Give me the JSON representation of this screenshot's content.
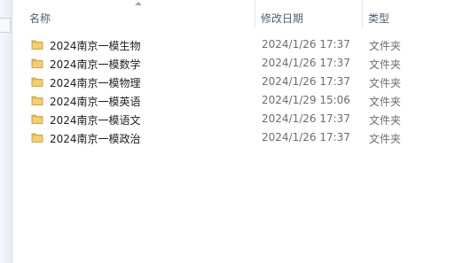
{
  "columns": {
    "name": "名称",
    "date": "修改日期",
    "type": "类型"
  },
  "files": [
    {
      "name": "2024南京一模生物",
      "date": "2024/1/26 17:37",
      "type": "文件夹",
      "icon": "folder-icon"
    },
    {
      "name": "2024南京一模数学",
      "date": "2024/1/26 17:37",
      "type": "文件夹",
      "icon": "folder-icon"
    },
    {
      "name": "2024南京一模物理",
      "date": "2024/1/26 17:37",
      "type": "文件夹",
      "icon": "folder-icon"
    },
    {
      "name": "2024南京一模英语",
      "date": "2024/1/29 15:06",
      "type": "文件夹",
      "icon": "folder-icon"
    },
    {
      "name": "2024南京一模语文",
      "date": "2024/1/26 17:37",
      "type": "文件夹",
      "icon": "folder-icon"
    },
    {
      "name": "2024南京一模政治",
      "date": "2024/1/26 17:37",
      "type": "文件夹",
      "icon": "folder-icon"
    }
  ],
  "colors": {
    "folder": "#e8b84a",
    "header_text": "#4c607a",
    "secondary_text": "#6d6d6d"
  }
}
